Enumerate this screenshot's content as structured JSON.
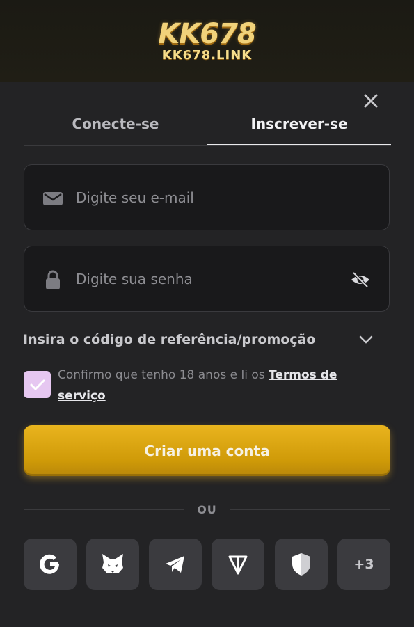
{
  "brand": {
    "name": "KK678",
    "domain": "KK678.LINK",
    "accent": "#f1d27a"
  },
  "tabs": [
    {
      "label": "Conecte-se",
      "active": false
    },
    {
      "label": "Inscrever-se",
      "active": true
    }
  ],
  "form": {
    "email": {
      "value": "",
      "placeholder": "Digite seu e-mail",
      "icon": "envelope-icon"
    },
    "password": {
      "value": "",
      "placeholder": "Digite sua senha",
      "icon": "lock-icon",
      "toggle_icon": "eye-off-icon"
    },
    "promo_label": "Insira o código de referência/promoção",
    "consent": {
      "checked": true,
      "text": "Confirmo que tenho 18 anos e li os ",
      "link": "Termos de serviço"
    },
    "submit_label": "Criar uma conta",
    "submit_color": "#d9a410"
  },
  "divider_label": "OU",
  "social": [
    {
      "name": "google-icon"
    },
    {
      "name": "metamask-icon"
    },
    {
      "name": "telegram-icon"
    },
    {
      "name": "ton-icon"
    },
    {
      "name": "shield-icon"
    },
    {
      "label": "+3"
    }
  ]
}
